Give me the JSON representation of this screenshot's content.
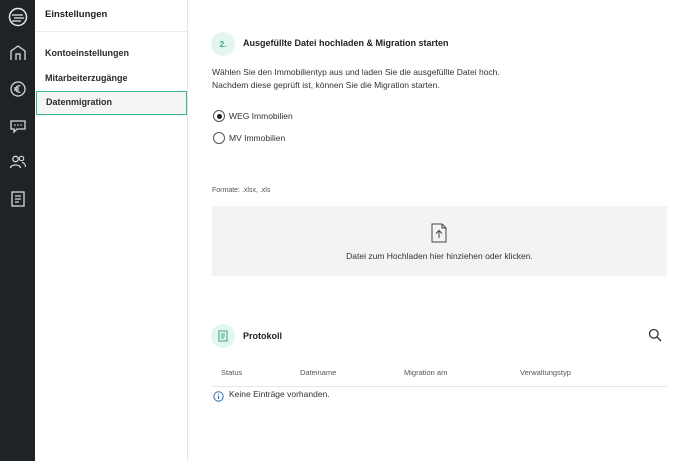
{
  "sidebar": {
    "title": "Einstellungen",
    "items": [
      {
        "label": "Kontoeinstellungen"
      },
      {
        "label": "Mitarbeiterzugänge"
      },
      {
        "label": "Datenmigration"
      }
    ]
  },
  "rail": {
    "icons": [
      "logo-icon",
      "home-icon",
      "euro-icon",
      "chat-icon",
      "users-icon",
      "document-list-icon"
    ]
  },
  "step": {
    "number": "2.",
    "title": "Ausgefüllte Datei hochladen & Migration starten",
    "description_line1": "Wählen Sie den Immobilientyp aus und laden Sie die ausgefüllte Datei hoch.",
    "description_line2": "Nachdem diese geprüft ist, können Sie die Migration starten."
  },
  "property_type": {
    "options": [
      {
        "label": "WEG Immobilien",
        "checked": true
      },
      {
        "label": "MV Immobilien",
        "checked": false
      }
    ]
  },
  "upload": {
    "formats": "Formate: .xlsx, .xls",
    "dropzone_text": "Datei zum Hochladen hier hinziehen oder klicken."
  },
  "protokoll": {
    "title": "Protokoll",
    "columns": [
      "Status",
      "Dateiname",
      "Migration am",
      "Verwaltungstyp"
    ],
    "empty_text": "Keine Einträge vorhanden."
  },
  "colors": {
    "accent": "#3cb88a",
    "rail_bg": "#1f2326",
    "dropzone_bg": "#f2f3f4",
    "info": "#2b6cb0"
  }
}
